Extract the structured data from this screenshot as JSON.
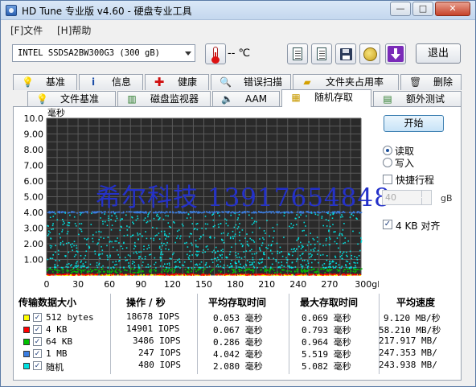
{
  "window": {
    "title": "HD Tune 专业版 v4.60 - 硬盘专业工具",
    "buttons": {
      "minimize": "—",
      "maximize": "□",
      "close": "✕"
    }
  },
  "menu": {
    "file": "[F]文件",
    "help": "[H]帮助"
  },
  "toolbar": {
    "drive": "INTEL SSDSA2BW300G3 (300 gB)",
    "temperature": "-- ℃",
    "exit": "退出"
  },
  "tabs_row1": [
    "基准",
    "信息",
    "健康",
    "错误扫描",
    "文件夹占用率",
    "删除"
  ],
  "tabs_row2": [
    "文件基准",
    "磁盘监视器",
    "AAM",
    "随机存取",
    "额外测试"
  ],
  "active_tab": "随机存取",
  "controls": {
    "start": "开始",
    "read": "读取",
    "write": "写入",
    "quick_scan": "快捷行程",
    "quick_scan_value": "40",
    "quick_scan_unit": "gB",
    "align_4kb": "4 KB 对齐"
  },
  "watermark": "希尔科技 13917654848",
  "chart_data": {
    "type": "scatter",
    "ylabel": "毫秒",
    "y_ticks": [
      "10.0",
      "9.00",
      "8.00",
      "7.00",
      "6.00",
      "5.00",
      "4.00",
      "3.00",
      "2.00",
      "1.00"
    ],
    "x_ticks": [
      "0",
      "30",
      "60",
      "90",
      "120",
      "150",
      "180",
      "210",
      "240",
      "270",
      "300gB"
    ],
    "ylim": [
      0,
      10
    ],
    "xlim": [
      0,
      300
    ],
    "grid": true,
    "series": [
      {
        "name": "512 bytes",
        "color": "#ffff00",
        "y_band": [
          0.03,
          0.07
        ]
      },
      {
        "name": "4 KB",
        "color": "#ff0000",
        "y_band": [
          0.04,
          0.12
        ]
      },
      {
        "name": "64 KB",
        "color": "#00c000",
        "y_band": [
          0.2,
          0.45
        ]
      },
      {
        "name": "1 MB",
        "color": "#3a7de0",
        "y_band": [
          4.0,
          4.1
        ]
      },
      {
        "name": "随机",
        "color": "#00e0e0",
        "y_band": [
          0.5,
          4.0
        ]
      }
    ]
  },
  "stats": {
    "headers": [
      "传输数据大小",
      "操作 / 秒",
      "平均存取时间",
      "最大存取时间",
      "平均速度"
    ],
    "rows": [
      {
        "color": "#ffff00",
        "check": "✓",
        "size": "512 bytes",
        "ops": "18678 IOPS",
        "avg": "0.053 毫秒",
        "max": "0.069 毫秒",
        "speed": "9.120 MB/秒"
      },
      {
        "color": "#ff0000",
        "check": "✓",
        "size": "4 KB",
        "ops": "14901 IOPS",
        "avg": "0.067 毫秒",
        "max": "0.793 毫秒",
        "speed": "58.210 MB/秒"
      },
      {
        "color": "#00c000",
        "check": "✓",
        "size": "64 KB",
        "ops": "3486 IOPS",
        "avg": "0.286 毫秒",
        "max": "0.964 毫秒",
        "speed": "217.917 MB/"
      },
      {
        "color": "#3a7de0",
        "check": "✓",
        "size": "1 MB",
        "ops": "247 IOPS",
        "avg": "4.042 毫秒",
        "max": "5.519 毫秒",
        "speed": "247.353 MB/"
      },
      {
        "color": "#00e0e0",
        "check": "✓",
        "size": "随机",
        "ops": "480 IOPS",
        "avg": "2.080 毫秒",
        "max": "5.082 毫秒",
        "speed": "243.938 MB/"
      }
    ]
  }
}
